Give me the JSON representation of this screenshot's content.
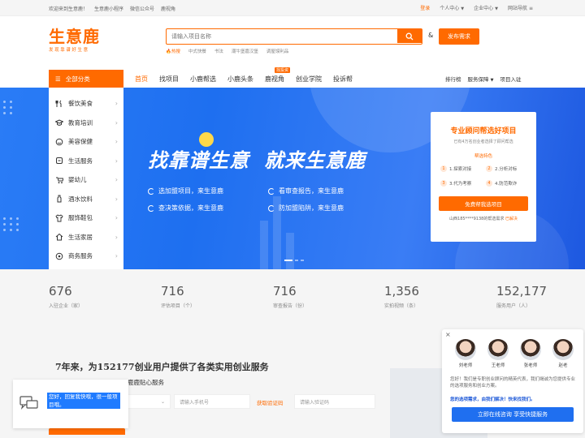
{
  "topbar": {
    "left": [
      "欢迎来到生意鹿！",
      "生意鹿小程序",
      "微信公众号",
      "鹿视角"
    ],
    "login": "登录",
    "personal": "个人中心",
    "enterprise": "企业中心",
    "sitemap": "网站导航"
  },
  "header": {
    "logo": "生意鹿",
    "logo_slogan": "发现靠谱好生意",
    "search_placeholder": "请输入项目名称",
    "amp": "&",
    "publish": "发布需求",
    "hot_label": "热搜",
    "hotwords": [
      "中式快餐",
      "书法",
      "潮牛堡嘉汉堡",
      "调屋馍利品"
    ]
  },
  "nav": {
    "all_categories": "全部分类",
    "items": [
      "首页",
      "找项目",
      "小鹿帮选",
      "小鹿头条",
      "鹿视角",
      "创业学院",
      "投诉帮"
    ],
    "badge": "找投资",
    "right": [
      "排行榜",
      "服务保障",
      "项目入驻"
    ]
  },
  "categories": [
    "餐饮美食",
    "教育培训",
    "美容保健",
    "生活服务",
    "婴幼儿",
    "酒水饮料",
    "服饰鞋包",
    "生活家居",
    "商务服务"
  ],
  "banner": {
    "headline_a": "找靠谱生意",
    "headline_b": "就来生意鹿",
    "features": [
      "选加盟项目，来生意鹿",
      "看审查报告，来生意鹿",
      "查决策依据，来生意鹿",
      "防加盟陷阱，来生意鹿"
    ]
  },
  "consult": {
    "title": "专业顾问帮选好项目",
    "subtitle": "已有4万名创业者选择了顾问帮选",
    "feature_label": "帮选特色",
    "steps": [
      {
        "n": "1",
        "t": "1.探索对接"
      },
      {
        "n": "2",
        "t": "2.分析对标"
      },
      {
        "n": "3",
        "t": "3.代为考察"
      },
      {
        "n": "4",
        "t": "4.防范欺诈"
      }
    ],
    "button": "免费帮我选项目",
    "footer": "山西185****9138的帮选需求",
    "solved": "已解决"
  },
  "stats": [
    {
      "num": "676",
      "label": "入驻企业（家）"
    },
    {
      "num": "716",
      "label": "评估项目（个）"
    },
    {
      "num": "716",
      "label": "审查报告（份）"
    },
    {
      "num": "1,356",
      "label": "实拍视频（条）"
    },
    {
      "num": "152,177",
      "label": "服务用户（人）"
    }
  ],
  "services": {
    "title": "7年来，为152177创业用户提供了各类实用创业服务",
    "subtitle": "鹿鹿贴心服务",
    "phone_placeholder": "请输入手机号",
    "get_code": "获取验证码",
    "code_placeholder": "请输入验证码"
  },
  "chat_left": {
    "message": "您好，回复我快哦，很一般项目哦。"
  },
  "advisor": {
    "close": "×",
    "advisors": [
      "刘老师",
      "王老师",
      "张老师",
      "赵老"
    ],
    "text": "您好！我们是专职创业顾问的精英代表，我们竭诚为您提供专业的选项服务和创业方案。",
    "emphasis": "您的选项需求，由我们解决！快来找我们。",
    "button": "立即在线咨询 享受快捷服务"
  },
  "colors": {
    "brand": "#ff6a00",
    "banner": "#2a7cf6",
    "link": "#1f6ff0"
  }
}
